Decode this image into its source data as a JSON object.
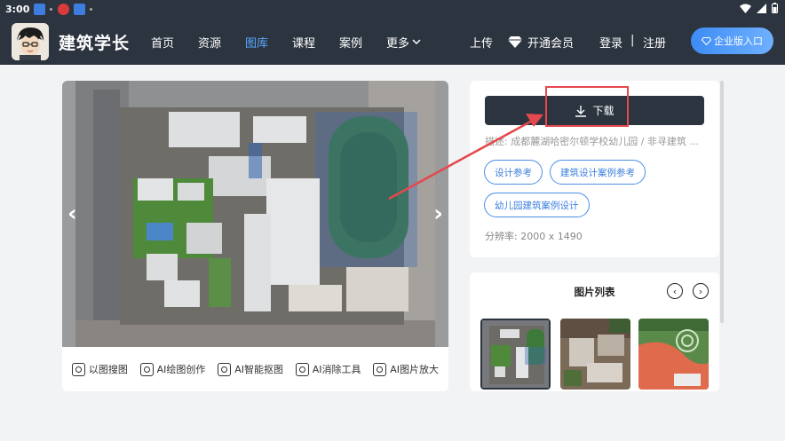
{
  "status_bar": {
    "time": "3:00"
  },
  "brand": {
    "name": "建筑学长"
  },
  "nav": {
    "items": [
      {
        "label": "首页"
      },
      {
        "label": "资源"
      },
      {
        "label": "图库"
      },
      {
        "label": "课程"
      },
      {
        "label": "案例"
      },
      {
        "label": "更多"
      }
    ],
    "upload": "上传",
    "vip": "开通会员",
    "login": "登录",
    "separator": "|",
    "register": "注册",
    "enterprise": "企业版入口"
  },
  "viewer": {
    "tools": [
      {
        "label": "以图搜图",
        "icon": "image-search-icon"
      },
      {
        "label": "AI绘图创作",
        "icon": "ai-draw-icon"
      },
      {
        "label": "AI智能抠图",
        "icon": "ai-cutout-icon"
      },
      {
        "label": "AI消除工具",
        "icon": "ai-erase-icon"
      },
      {
        "label": "AI图片放大",
        "icon": "ai-upscale-icon"
      }
    ]
  },
  "detail": {
    "download_label": "下载",
    "description": "描述: 成都麓湖哈密尔顿学校幼儿园 / 非寻建筑 ...",
    "tags": [
      "设计参考",
      "建筑设计案例参考",
      "幼儿园建筑案例设计"
    ],
    "resolution": "分辨率: 2000 x 1490"
  },
  "image_list": {
    "title": "图片列表"
  },
  "colors": {
    "nav_bg": "#2c3440",
    "accent": "#3b7fdc",
    "highlight": "#e5484d"
  }
}
